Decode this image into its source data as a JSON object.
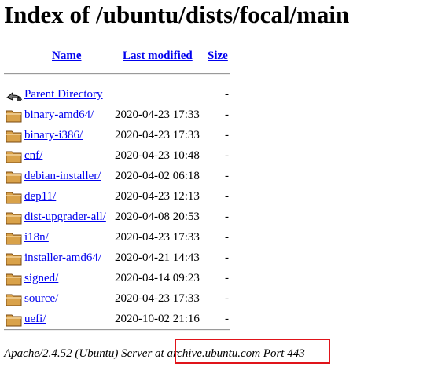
{
  "page": {
    "title": "Index of /ubuntu/dists/focal/main"
  },
  "columns": {
    "name": "Name",
    "last_modified": "Last modified",
    "size": "Size"
  },
  "parent": {
    "label": "Parent Directory",
    "date": "",
    "size": "-",
    "icon": "back-arrow-icon"
  },
  "entries": [
    {
      "name": "binary-amd64/",
      "date": "2020-04-23 17:33",
      "size": "-",
      "icon": "folder-icon"
    },
    {
      "name": "binary-i386/",
      "date": "2020-04-23 17:33",
      "size": "-",
      "icon": "folder-icon"
    },
    {
      "name": "cnf/",
      "date": "2020-04-23 10:48",
      "size": "-",
      "icon": "folder-icon"
    },
    {
      "name": "debian-installer/",
      "date": "2020-04-02 06:18",
      "size": "-",
      "icon": "folder-icon"
    },
    {
      "name": "dep11/",
      "date": "2020-04-23 12:13",
      "size": "-",
      "icon": "folder-icon"
    },
    {
      "name": "dist-upgrader-all/",
      "date": "2020-04-08 20:53",
      "size": "-",
      "icon": "folder-icon"
    },
    {
      "name": "i18n/",
      "date": "2020-04-23 17:33",
      "size": "-",
      "icon": "folder-icon"
    },
    {
      "name": "installer-amd64/",
      "date": "2020-04-21 14:43",
      "size": "-",
      "icon": "folder-icon"
    },
    {
      "name": "signed/",
      "date": "2020-04-14 09:23",
      "size": "-",
      "icon": "folder-icon"
    },
    {
      "name": "source/",
      "date": "2020-04-23 17:33",
      "size": "-",
      "icon": "folder-icon"
    },
    {
      "name": "uefi/",
      "date": "2020-10-02 21:16",
      "size": "-",
      "icon": "folder-icon"
    }
  ],
  "footer": {
    "text": "Apache/2.4.52 (Ubuntu) Server at archive.ubuntu.com Port 443"
  },
  "highlight_color": "#e0141a",
  "link_color": "#0000ee"
}
